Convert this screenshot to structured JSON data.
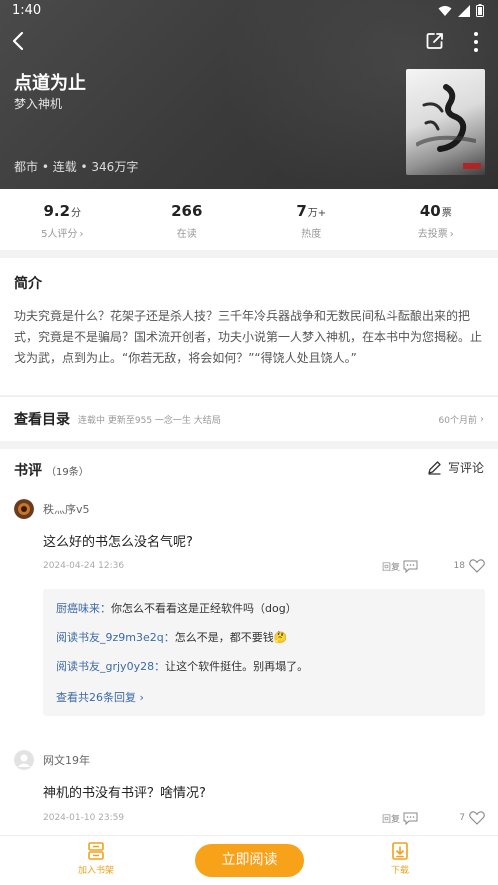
{
  "status_bar": {
    "time": "1:40"
  },
  "book": {
    "title": "点道为止",
    "author": "梦入神机",
    "meta": "都市 • 连载 • 346万字"
  },
  "stats": [
    {
      "value": "9.2",
      "unit": "分",
      "label": "5人评分",
      "has_chevron": true
    },
    {
      "value": "266",
      "unit": "",
      "label": "在读",
      "has_chevron": false
    },
    {
      "value": "7",
      "unit": "万+",
      "label": "热度",
      "has_chevron": false
    },
    {
      "value": "40",
      "unit": "票",
      "label": "去投票",
      "has_chevron": true
    }
  ],
  "intro": {
    "heading": "简介",
    "text": "功夫究竟是什么？花架子还是杀人技？三千年冷兵器战争和无数民间私斗酝酿出来的把式，究竟是不是骗局？国术流开创者，功夫小说第一人梦入神机，在本书中为您揭秘。止戈为武，点到为止。“你若无敌，将会如何？”“得饶人处且饶人。”"
  },
  "catalog": {
    "heading": "查看目录",
    "status": "连载中 更新至955 一念一生 大结局",
    "time": "60个月前"
  },
  "reviews": {
    "heading": "书评",
    "count": "（19条）",
    "write_label": "写评论",
    "items": [
      {
        "user": "秩灬序v5",
        "text": "这么好的书怎么没名气呢?",
        "date": "2024-04-24 12:36",
        "reply_label": "回复",
        "likes": "18"
      },
      {
        "user": "网文19年",
        "text": "神机的书没有书评？啥情况?",
        "date": "2024-01-10 23:59",
        "reply_label": "回复",
        "likes": "7"
      }
    ],
    "replies": [
      {
        "name": "厨癌味来：",
        "text": "你怎么不看看这是正经软件吗（dog）"
      },
      {
        "name": "阅读书友_9z9m3e2q：",
        "text": "怎么不是，都不要钱🤔"
      },
      {
        "name": "阅读书友_grjy0y28：",
        "text": "让这个软件挺住。别再塌了。"
      }
    ],
    "more_replies": "查看共26条回复"
  },
  "bottom_bar": {
    "add_shelf": "加入书架",
    "read_now": "立即阅读",
    "download": "下载"
  },
  "colors": {
    "accent": "#f8a219",
    "link": "#3d6aa8"
  }
}
